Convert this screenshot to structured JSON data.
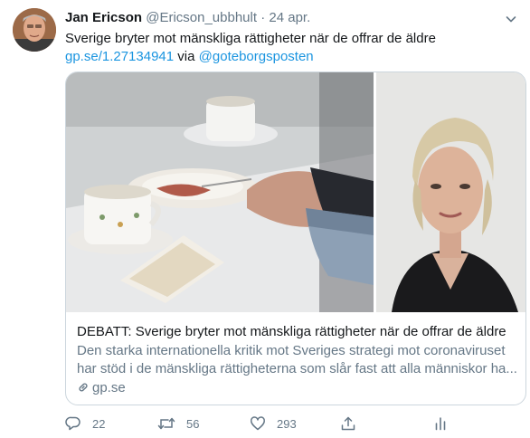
{
  "author": {
    "name": "Jan Ericson",
    "handle": "@Ericson_ubbhult",
    "separator": "·",
    "date": "24 apr."
  },
  "tweet": {
    "text": "Sverige bryter mot mänskliga rättigheter när de offrar de äldre",
    "link": "gp.se/1.27134941",
    "via": "via",
    "mention": "@goteborgsposten"
  },
  "card": {
    "title": "DEBATT: Sverige bryter mot mänskliga rättigheter när de offrar de äldre",
    "description_line1": "Den starka internationella kritik mot Sveriges strategi mot coronaviruset",
    "description_line2": "har stöd i de mänskliga rättigheterna som slår fast att alla människor ha...",
    "domain": "gp.se"
  },
  "actions": {
    "reply_count": "22",
    "retweet_count": "56",
    "like_count": "293"
  },
  "colors": {
    "link": "#1b95e0",
    "secondary_text": "#657786",
    "border": "#ccd6dd"
  },
  "icons": [
    "caret-down-icon",
    "link-icon",
    "reply-icon",
    "retweet-icon",
    "like-icon",
    "share-icon",
    "analytics-icon"
  ]
}
